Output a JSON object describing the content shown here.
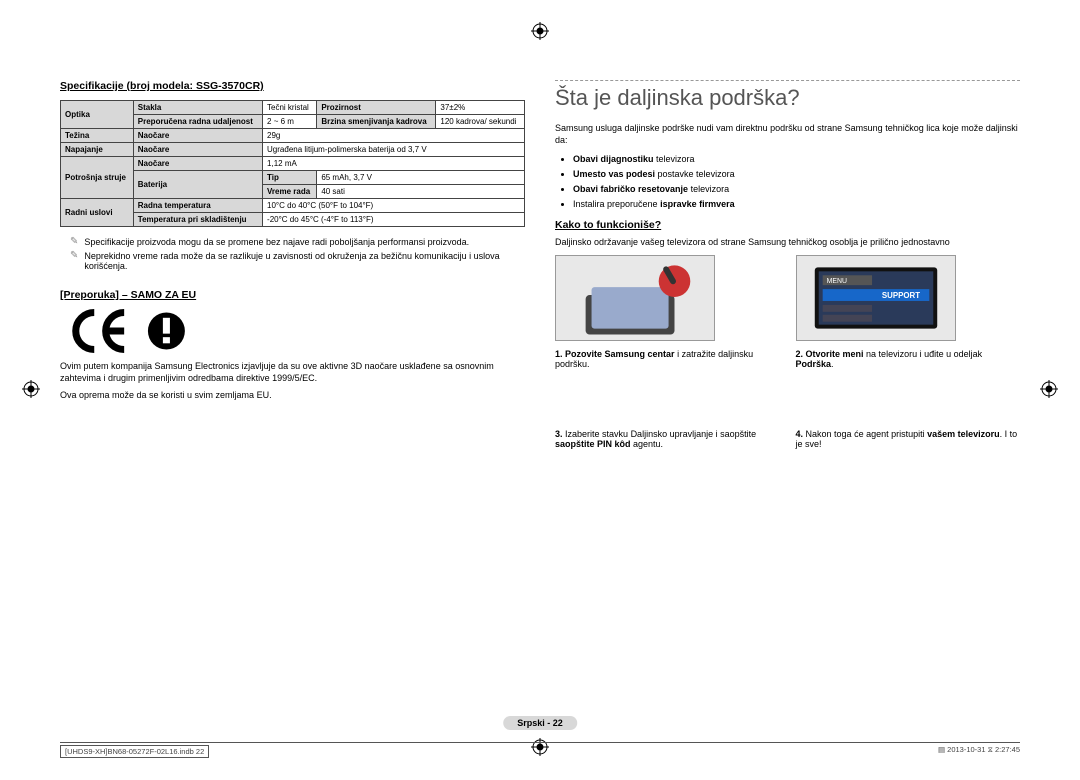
{
  "left": {
    "spec_heading": "Specifikacije (broj modela: SSG-3570CR)",
    "table": {
      "r1c1": "Optika",
      "r1c2": "Stakla",
      "r1c3": "Tečni kristal",
      "r1c4": "Prozirnost",
      "r1c5": "37±2%",
      "r2c2": "Preporučena radna udaljenost",
      "r2c3": "2 ~ 6 m",
      "r2c4": "Brzina smenjivanja kadrova",
      "r2c5": "120 kadrova/ sekundi",
      "r3c1": "Težina",
      "r3c2": "Naočare",
      "r3c3": "29g",
      "r4c1": "Napajanje",
      "r4c2": "Naočare",
      "r4c3": "Ugrađena litijum-polimerska baterija od 3,7 V",
      "r5c1": "Potrošnja struje",
      "r5c2": "Naočare",
      "r5c3": "1,12 mA",
      "r6c2": "Baterija",
      "r6c3": "Tip",
      "r6c4": "65 mAh, 3,7 V",
      "r7c3": "Vreme rada",
      "r7c4": "40 sati",
      "r8c1": "Radni uslovi",
      "r8c2": "Radna temperatura",
      "r8c3": "10°C do 40°C (50°F to 104°F)",
      "r9c2": "Temperatura pri skladištenju",
      "r9c3": "-20°C do 45°C (-4°F to 113°F)"
    },
    "note1": "Specifikacije proizvoda mogu da se promene bez najave radi poboljšanja performansi proizvoda.",
    "note2": "Neprekidno vreme rada može da se razlikuje u zavisnosti od okruženja za bežičnu komunikaciju i uslova korišćenja.",
    "eu_heading": "[Preporuka] – SAMO ZA EU",
    "eu_para1": "Ovim putem kompanija Samsung Electronics izjavljuje da su ove aktivne 3D naočare usklađene sa osnovnim zahtevima i drugim primenljivim odredbama direktive 1999/5/EC.",
    "eu_para2": "Ova oprema može da se koristi u svim zemljama EU."
  },
  "right": {
    "title": "Šta je daljinska podrška?",
    "intro": "Samsung usluga daljinske podrške nudi vam direktnu podršku od strane Samsung tehničkog lica koje može daljinski da:",
    "b1_b": "Obavi dijagnostiku",
    "b1_t": " televizora",
    "b2_b": "Umesto vas podesi",
    "b2_t": " postavke televizora",
    "b3_b": "Obavi fabričko resetovanje",
    "b3_t": " televizora",
    "b4_t1": "Instalira preporučene ",
    "b4_b": "ispravke firmvera",
    "how_heading": "Kako to funkcioniše?",
    "how_para": "Daljinsko održavanje vašeg televizora od strane Samsung tehničkog osoblja je prilično jednostavno",
    "s1_n": "1.",
    "s1_b": "Pozovite Samsung centar",
    "s1_t": " i zatražite daljinsku podršku.",
    "s2_n": "2.",
    "s2_b": "Otvorite meni",
    "s2_t": " na televizoru i uđite u odeljak ",
    "s2_b2": "Podrška",
    "s2_t2": ".",
    "s3_n": "3.",
    "s3_t1": "Izaberite stavku Daljinsko upravljanje i saopštite ",
    "s3_b": "saopštite PIN kôd",
    "s3_t2": " agentu.",
    "s4_n": "4.",
    "s4_t1": "Nakon toga će agent pristupiti ",
    "s4_b": "vašem televizoru",
    "s4_t2": ". I to je sve!",
    "support_label": "SUPPORT",
    "menu_label": "MENU"
  },
  "footer": {
    "page_label": "Srpski - 22",
    "file": "[UHDS9-XH]BN68-05272F-02L16.indb   22",
    "date_icon": "▤",
    "date": "2013-10-31   ",
    "time_icon": "⧖",
    "time": "2:27:45"
  }
}
